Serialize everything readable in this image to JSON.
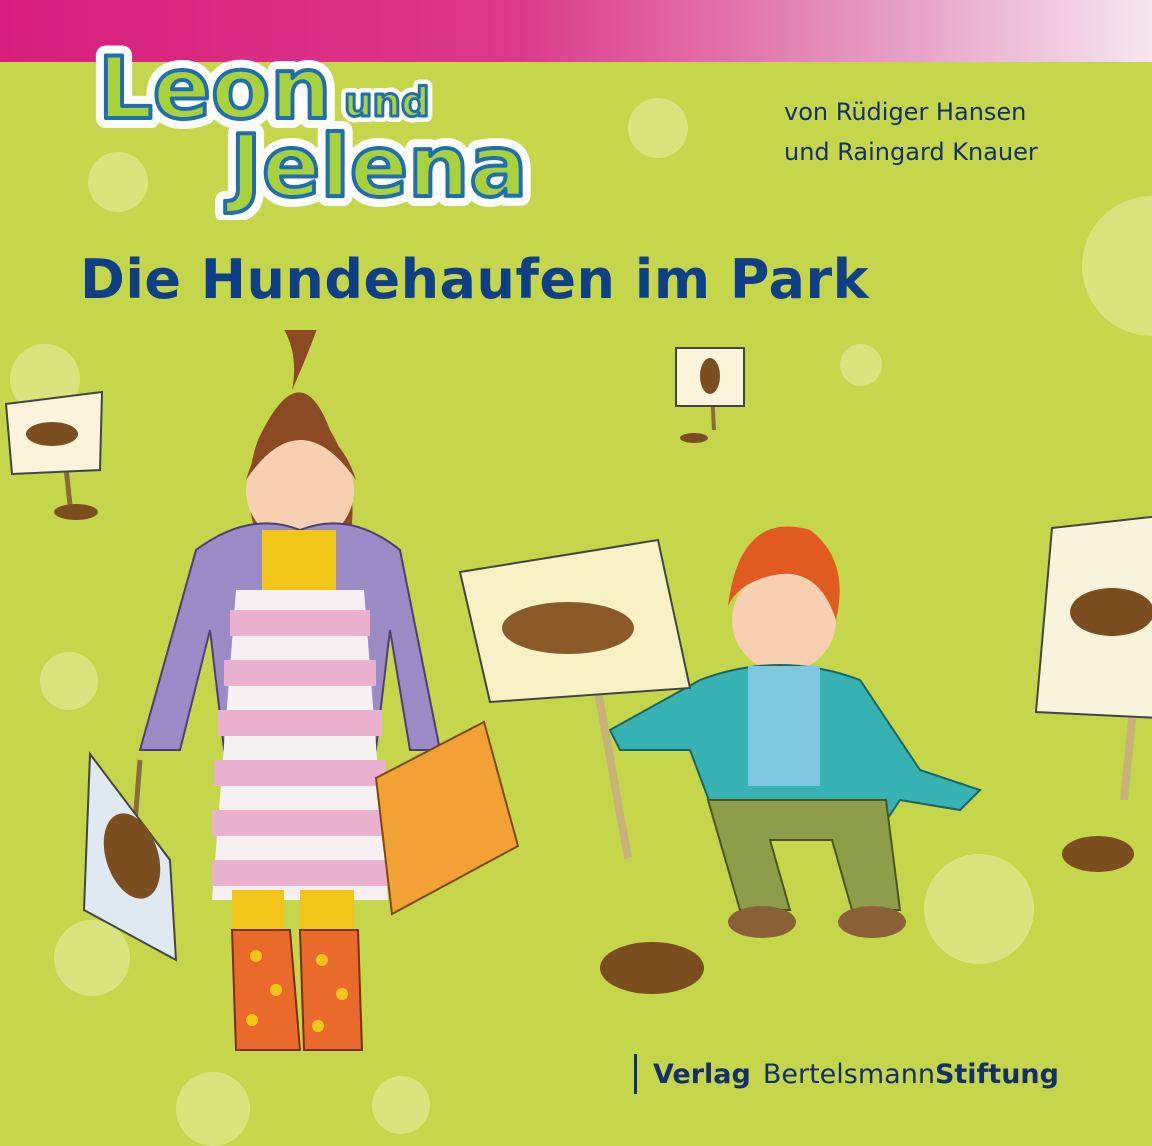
{
  "series_logo": {
    "line1": "Leon",
    "connector": "und",
    "line2": "Jelena"
  },
  "authors": {
    "line1": "von Rüdiger Hansen",
    "line2": "und Raingard Knauer"
  },
  "title": "Die Hundehaufen im Park",
  "publisher": {
    "verlag": "Verlag",
    "name_regular": "Bertelsmann",
    "name_bold": "Stiftung"
  },
  "colors": {
    "background": "#c5d64a",
    "top_bar": "#d81e7c",
    "title": "#0f3f86",
    "logo_fill": "#a9d23a",
    "logo_outline": "#1f6fb0"
  }
}
